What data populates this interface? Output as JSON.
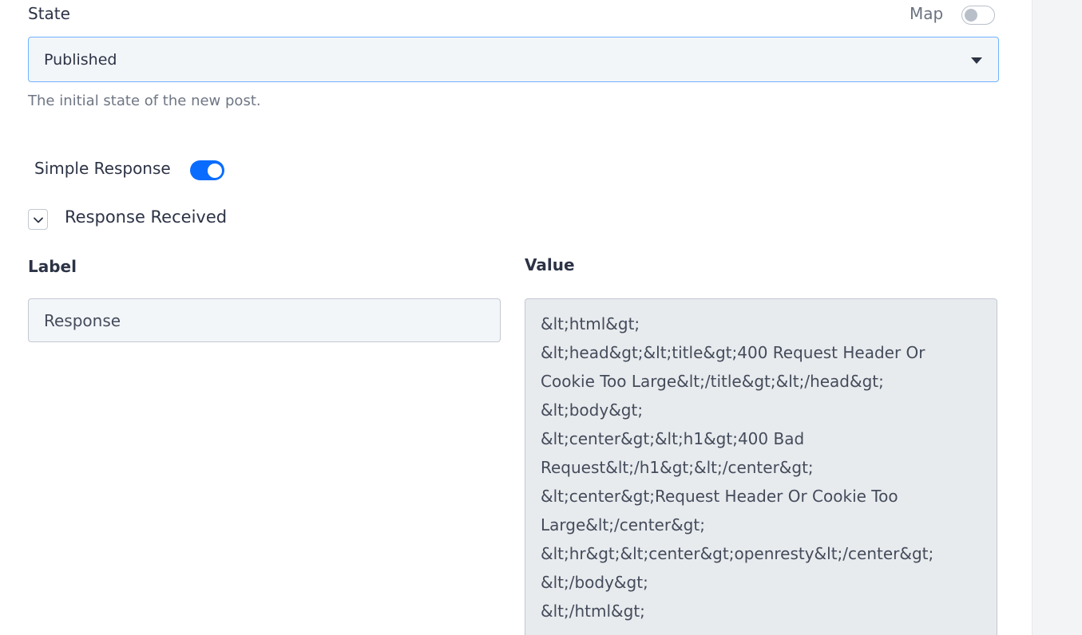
{
  "state_field": {
    "label": "State",
    "selected": "Published",
    "help": "The initial state of the new post.",
    "map_label": "Map",
    "map_enabled": false
  },
  "simple_response": {
    "label": "Simple Response",
    "enabled": true
  },
  "response_section": {
    "title": "Response Received",
    "expanded": true,
    "label_header": "Label",
    "value_header": "Value",
    "label_value": "Response",
    "value_lines": [
      "&lt;html&gt;",
      "&lt;head&gt;&lt;title&gt;400 Request Header Or",
      "Cookie Too Large&lt;/title&gt;&lt;/head&gt;",
      "&lt;body&gt;",
      "&lt;center&gt;&lt;h1&gt;400 Bad",
      "Request&lt;/h1&gt;&lt;/center&gt;",
      "&lt;center&gt;Request Header Or Cookie Too",
      "Large&lt;/center&gt;",
      "&lt;hr&gt;&lt;center&gt;openresty&lt;/center&gt;",
      "&lt;/body&gt;",
      "&lt;/html&gt;"
    ]
  },
  "colors": {
    "accent": "#0a6cff",
    "select_border": "#6fb2ff",
    "text": "#2c3345",
    "muted": "#6f7684",
    "readonly_bg": "#e8ebee"
  },
  "icons": {
    "select_caret": "caret-down-icon",
    "collapse": "chevron-down-icon"
  }
}
